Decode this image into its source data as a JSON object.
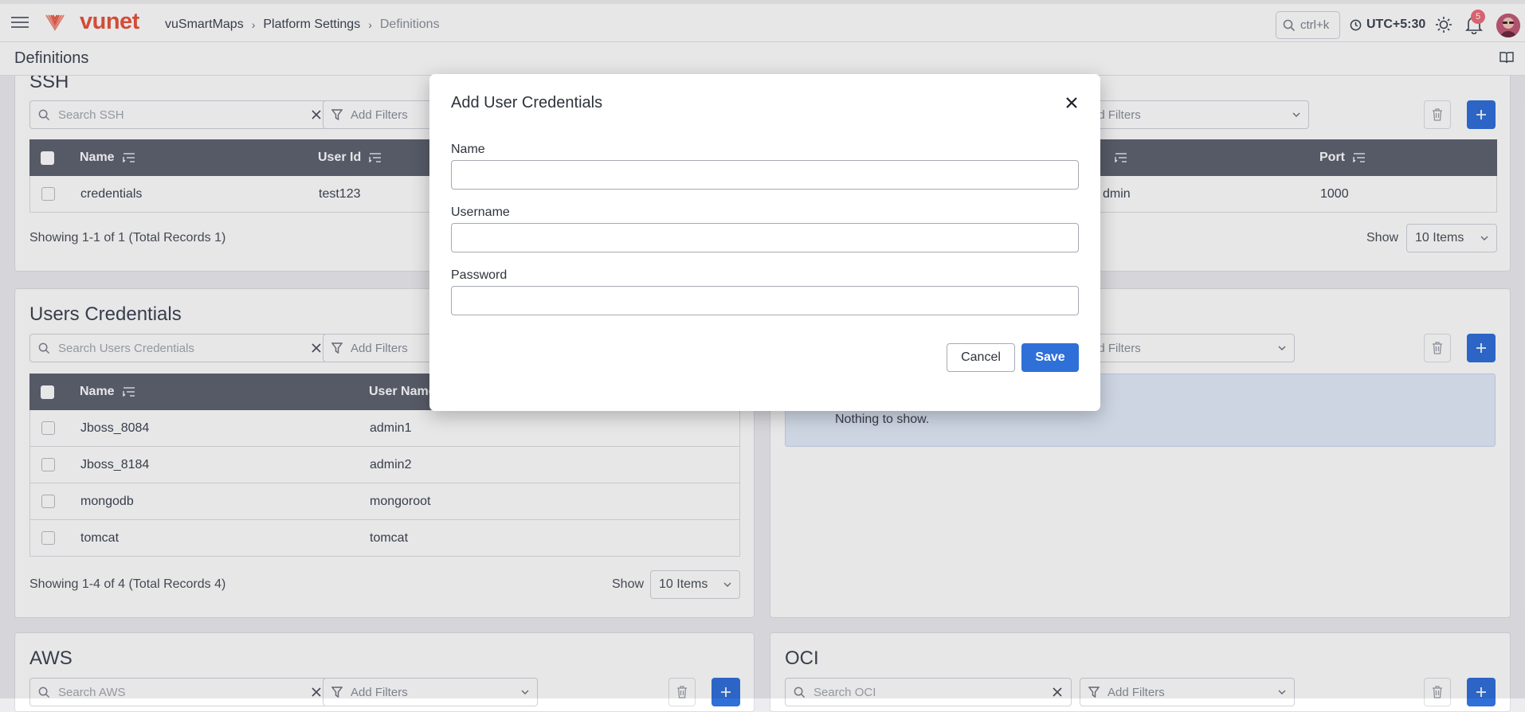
{
  "header": {
    "brand": "vunet",
    "breadcrumb": [
      "vuSmartMaps",
      "Platform Settings",
      "Definitions"
    ],
    "search_hint": "ctrl+k",
    "timezone": "UTC+5:30",
    "notification_count": "5",
    "colors": {
      "brand": "#e8533a",
      "accent": "#2f6fd8",
      "badge": "#ee6d79"
    }
  },
  "page": {
    "title": "Definitions"
  },
  "ssh": {
    "title": "SSH",
    "search_placeholder": "Search SSH",
    "filter_placeholder": "Add Filters",
    "right_filter_placeholder": "Add Filters",
    "columns": [
      "Name",
      "User Id",
      "Port"
    ],
    "partial_column_value": "dmin",
    "rows": [
      {
        "name": "credentials",
        "user_id": "test123",
        "port": "1000"
      }
    ],
    "footer": "Showing 1-1 of 1 (Total Records 1)",
    "show_label": "Show",
    "page_size": "10 Items"
  },
  "users_credentials": {
    "title": "Users Credentials",
    "search_placeholder": "Search Users Credentials",
    "filter_placeholder": "Add Filters",
    "columns": [
      "Name",
      "User Name"
    ],
    "rows": [
      {
        "name": "Jboss_8084",
        "user_name": "admin1"
      },
      {
        "name": "Jboss_8184",
        "user_name": "admin2"
      },
      {
        "name": "mongodb",
        "user_name": "mongoroot"
      },
      {
        "name": "tomcat",
        "user_name": "tomcat"
      }
    ],
    "footer": "Showing 1-4 of 4 (Total Records 4)",
    "show_label": "Show",
    "page_size": "10 Items"
  },
  "right_panel": {
    "filter_placeholder": "Add Filters",
    "empty_text": "Nothing to show."
  },
  "aws": {
    "title": "AWS",
    "search_placeholder": "Search AWS",
    "filter_placeholder": "Add Filters"
  },
  "oci": {
    "title": "OCI",
    "search_placeholder": "Search OCI",
    "filter_placeholder": "Add Filters"
  },
  "modal": {
    "title": "Add User Credentials",
    "fields": {
      "name": {
        "label": "Name",
        "value": ""
      },
      "username": {
        "label": "Username",
        "value": ""
      },
      "password": {
        "label": "Password",
        "value": ""
      }
    },
    "cancel_label": "Cancel",
    "save_label": "Save"
  }
}
